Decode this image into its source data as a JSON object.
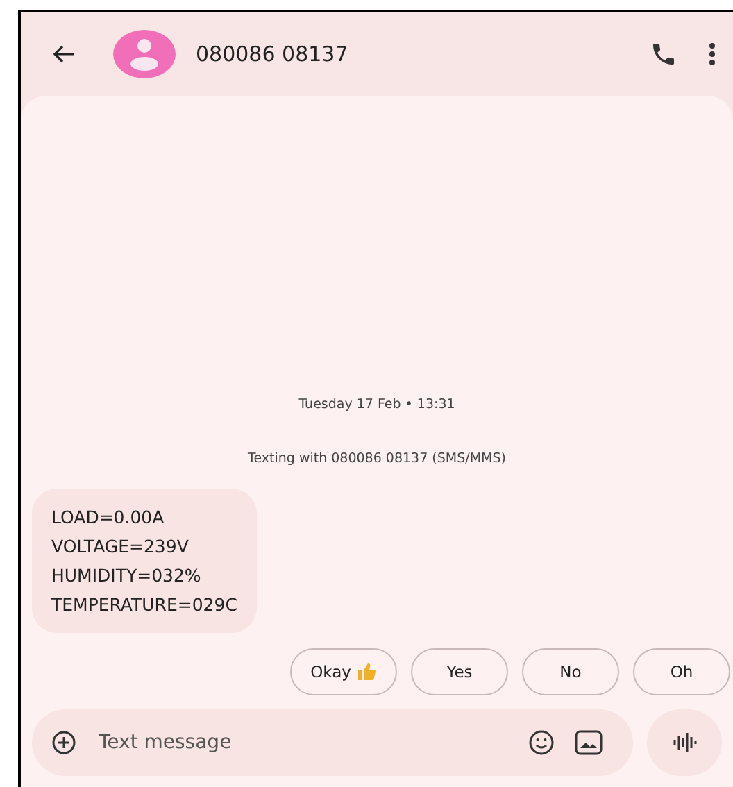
{
  "header": {
    "contact": "080086 08137"
  },
  "conversation": {
    "date": "Tuesday 17 Feb • 13:31",
    "info": "Texting with 080086 08137 (SMS/MMS)",
    "messages": [
      {
        "lines": [
          "LOAD=0.00A",
          "VOLTAGE=239V",
          "HUMIDITY=032%",
          "TEMPERATURE=029C"
        ]
      }
    ]
  },
  "suggestions": [
    {
      "label": "Okay",
      "kind": "thumbs"
    },
    {
      "label": "Yes",
      "kind": "text"
    },
    {
      "label": "No",
      "kind": "text"
    },
    {
      "label": "Oh",
      "kind": "text"
    }
  ],
  "composer": {
    "placeholder": "Text message"
  }
}
